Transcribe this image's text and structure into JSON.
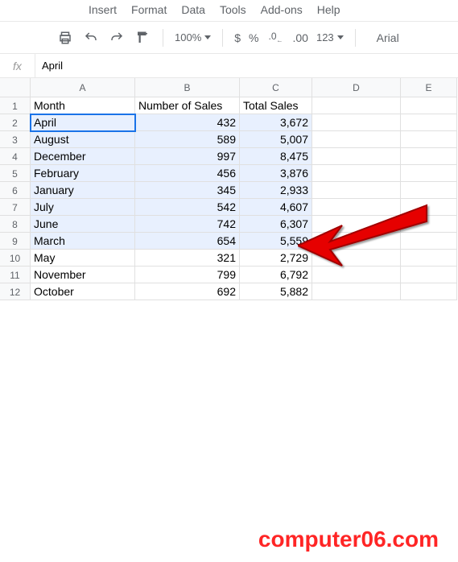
{
  "menu": {
    "insert": "Insert",
    "format": "Format",
    "data": "Data",
    "tools": "Tools",
    "addons": "Add-ons",
    "help": "Help"
  },
  "toolbar": {
    "zoom": "100%",
    "currency": "$",
    "percent": "%",
    "dec_dec": ".0",
    "dec_inc": ".00",
    "more_fmt": "123",
    "font": "Arial"
  },
  "formula": {
    "fx": "fx",
    "value": "April"
  },
  "columns": [
    "A",
    "B",
    "C",
    "D",
    "E"
  ],
  "rows_vis": [
    "1",
    "2",
    "3",
    "4",
    "5",
    "6",
    "7",
    "8",
    "9",
    "10",
    "11",
    "12"
  ],
  "headers": {
    "a": "Month",
    "b": "Number of Sales",
    "c": "Total Sales"
  },
  "data": [
    {
      "month": "April",
      "sales": "432",
      "total": "3,672"
    },
    {
      "month": "August",
      "sales": "589",
      "total": "5,007"
    },
    {
      "month": "December",
      "sales": "997",
      "total": "8,475"
    },
    {
      "month": "February",
      "sales": "456",
      "total": "3,876"
    },
    {
      "month": "January",
      "sales": "345",
      "total": "2,933"
    },
    {
      "month": "July",
      "sales": "542",
      "total": "4,607"
    },
    {
      "month": "June",
      "sales": "742",
      "total": "6,307"
    },
    {
      "month": "March",
      "sales": "654",
      "total": "5,559"
    },
    {
      "month": "May",
      "sales": "321",
      "total": "2,729"
    },
    {
      "month": "November",
      "sales": "799",
      "total": "6,792"
    },
    {
      "month": "October",
      "sales": "692",
      "total": "5,882"
    }
  ],
  "watermark": "computer06.com"
}
